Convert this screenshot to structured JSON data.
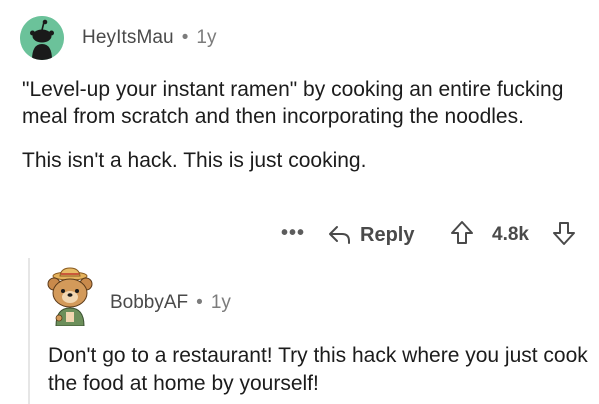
{
  "comment1": {
    "username": "HeyItsMau",
    "separator": "•",
    "age": "1y",
    "paragraphs": [
      "\"Level-up your instant ramen\" by cooking an entire fucking meal from scratch and then incorporating the noodles.",
      "This isn't a hack. This is just cooking."
    ],
    "actions": {
      "more_label": "•••",
      "reply_label": "Reply",
      "score": "4.8k"
    }
  },
  "comment2": {
    "username": "BobbyAF",
    "separator": "•",
    "age": "1y",
    "text": "Don't go to a restaurant! Try this hack where you just cook the food at home by yourself!"
  },
  "colors": {
    "avatar1_bg": "#6bc29a",
    "text_primary": "#1c1c1c",
    "text_meta": "#7c7c7c"
  }
}
